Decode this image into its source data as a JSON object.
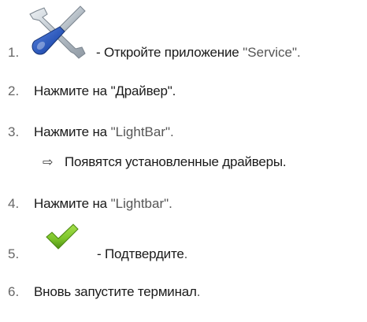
{
  "steps": [
    {
      "num": "1.",
      "parts": [
        "Откройте приложение",
        "\"Service\"."
      ],
      "prefix": "- ",
      "icon": "service-tools-icon"
    },
    {
      "num": "2.",
      "parts": [
        "Нажмите на",
        "\"Драйвер\"."
      ]
    },
    {
      "num": "3.",
      "parts": [
        "Нажмите на",
        "\"LightBar\"."
      ],
      "result": "Появятся установленные драйверы."
    },
    {
      "num": "4.",
      "parts": [
        "Нажмите на",
        "\"Lightbar\"."
      ]
    },
    {
      "num": "5.",
      "parts": [
        "Подтвердите",
        "."
      ],
      "prefix": "- ",
      "icon": "checkmark-icon"
    },
    {
      "num": "6.",
      "parts": [
        "Вновь запустите терминал",
        "."
      ]
    }
  ],
  "result_arrow": "⇨",
  "colors": {
    "tool_blue": "#2a56b8",
    "tool_silver": "#c9d0d6",
    "check_green": "#7cc42a"
  }
}
